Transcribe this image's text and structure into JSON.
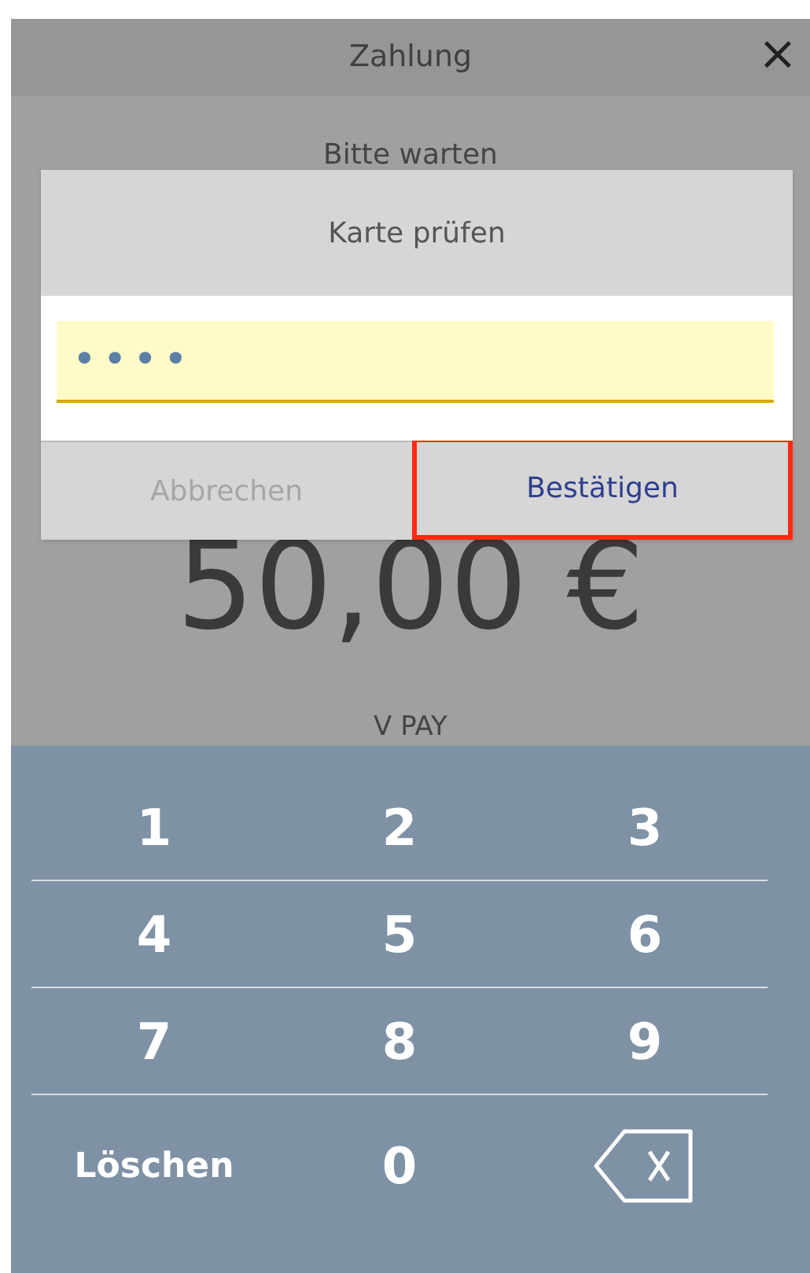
{
  "window": {
    "title": "Zahlung",
    "close": "×"
  },
  "status": "Bitte warten",
  "amount": "50,00 €",
  "card_type": "V PAY",
  "dialog": {
    "title": "Karte prüfen",
    "pin_value": "••••",
    "buttons": [
      {
        "label": "Abbrechen",
        "disabled": true,
        "highlighted": false
      },
      {
        "label": "Bestätigen",
        "disabled": false,
        "highlighted": true
      }
    ]
  },
  "keypad": [
    [
      {
        "kind": "digit",
        "label": "1"
      },
      {
        "kind": "digit",
        "label": "2"
      },
      {
        "kind": "digit",
        "label": "3"
      }
    ],
    [
      {
        "kind": "digit",
        "label": "4"
      },
      {
        "kind": "digit",
        "label": "5"
      },
      {
        "kind": "digit",
        "label": "6"
      }
    ],
    [
      {
        "kind": "digit",
        "label": "7"
      },
      {
        "kind": "digit",
        "label": "8"
      },
      {
        "kind": "digit",
        "label": "9"
      }
    ],
    [
      {
        "kind": "text",
        "label": "Löschen"
      },
      {
        "kind": "digit",
        "label": "0"
      },
      {
        "kind": "backspace"
      }
    ]
  ]
}
